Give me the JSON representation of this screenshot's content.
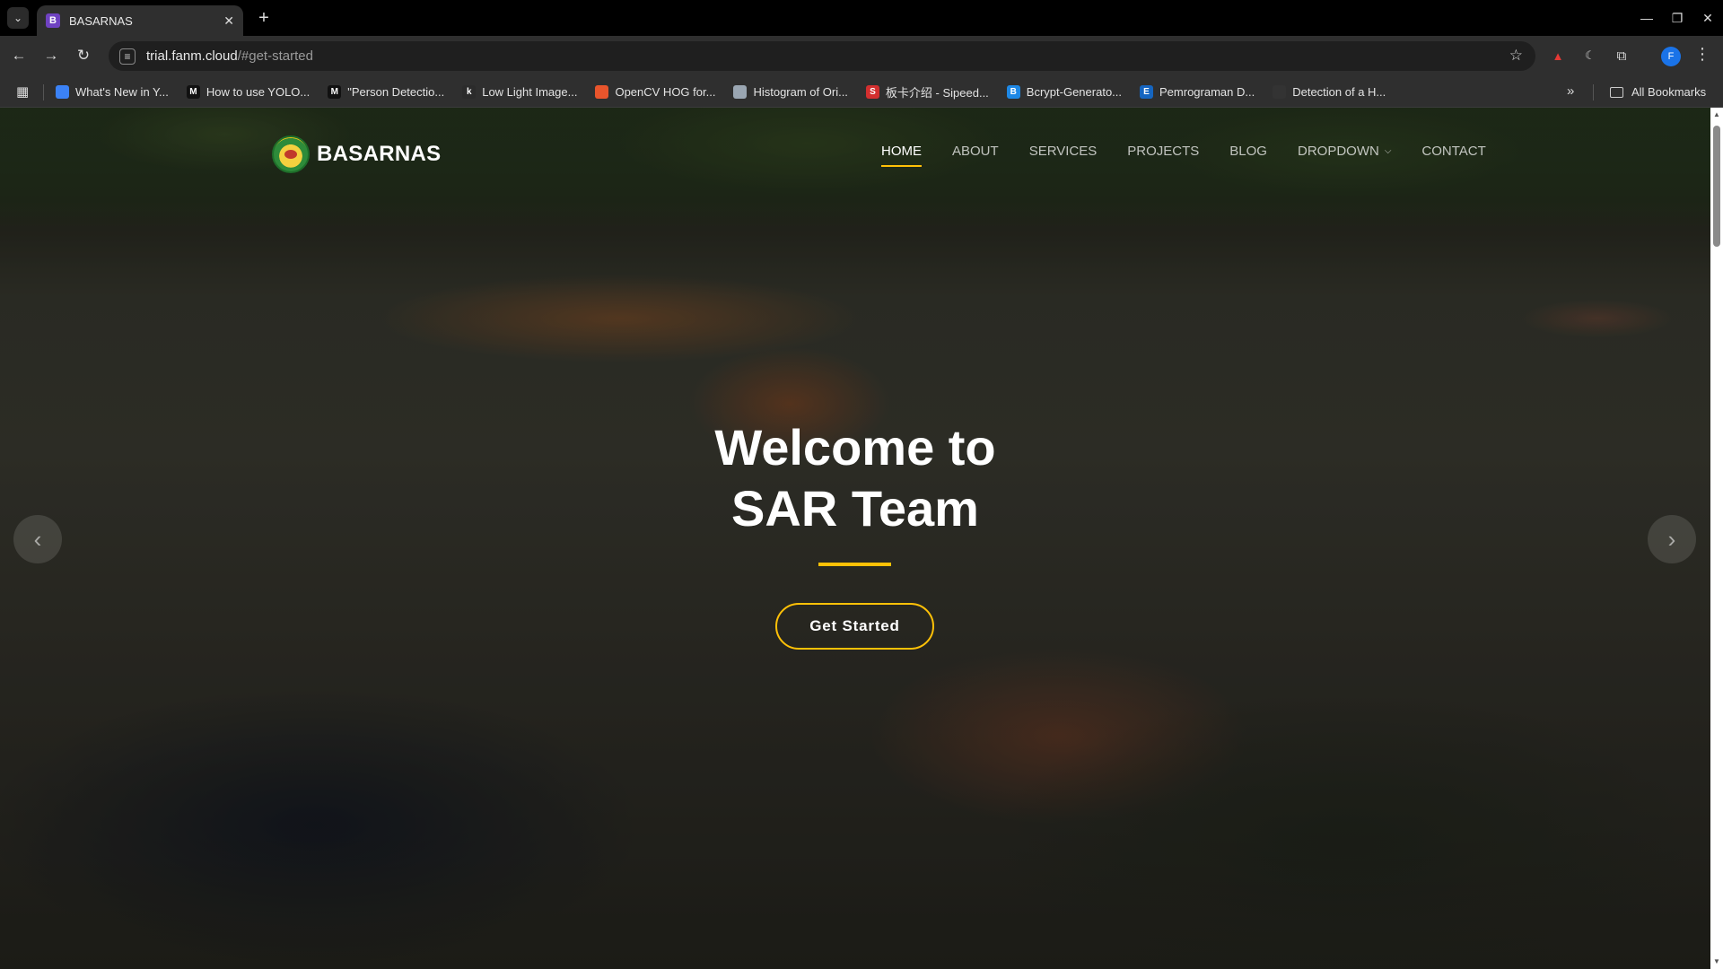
{
  "browser": {
    "tab_title": "BASARNAS",
    "tab_favicon": "B",
    "url_host": "trial.fanm.cloud",
    "url_path": "/#get-started",
    "profile_initial": "F",
    "bookmarks": [
      {
        "label": "What's New in Y...",
        "icon_color": "#3b82f6",
        "icon": ""
      },
      {
        "label": "How to use YOLO...",
        "icon_color": "#111111",
        "icon": "M"
      },
      {
        "label": "\"Person Detectio...",
        "icon_color": "#111111",
        "icon": "M"
      },
      {
        "label": "Low Light Image...",
        "icon_color": "#2b2b2b",
        "icon": "k"
      },
      {
        "label": "OpenCV HOG for...",
        "icon_color": "#e8552c",
        "icon": ""
      },
      {
        "label": "Histogram of Ori...",
        "icon_color": "#9aa6b2",
        "icon": ""
      },
      {
        "label": "板卡介绍 - Sipeed...",
        "icon_color": "#d32f2f",
        "icon": "S"
      },
      {
        "label": "Bcrypt-Generato...",
        "icon_color": "#1e88e5",
        "icon": "B"
      },
      {
        "label": "Pemrograman D...",
        "icon_color": "#1565c0",
        "icon": "E"
      },
      {
        "label": "Detection of a H...",
        "icon_color": "#333333",
        "icon": ""
      }
    ],
    "all_bookmarks_label": "All Bookmarks"
  },
  "site": {
    "brand": "BASARNAS",
    "nav": [
      {
        "label": "HOME",
        "active": true
      },
      {
        "label": "ABOUT",
        "active": false
      },
      {
        "label": "SERVICES",
        "active": false
      },
      {
        "label": "PROJECTS",
        "active": false
      },
      {
        "label": "BLOG",
        "active": false
      },
      {
        "label": "DROPDOWN",
        "active": false,
        "has_chevron": true
      },
      {
        "label": "CONTACT",
        "active": false
      }
    ],
    "hero": {
      "title_line1": "Welcome to",
      "title_line2": "SAR Team",
      "cta_label": "Get Started"
    },
    "colors": {
      "accent": "#ffc107"
    }
  }
}
